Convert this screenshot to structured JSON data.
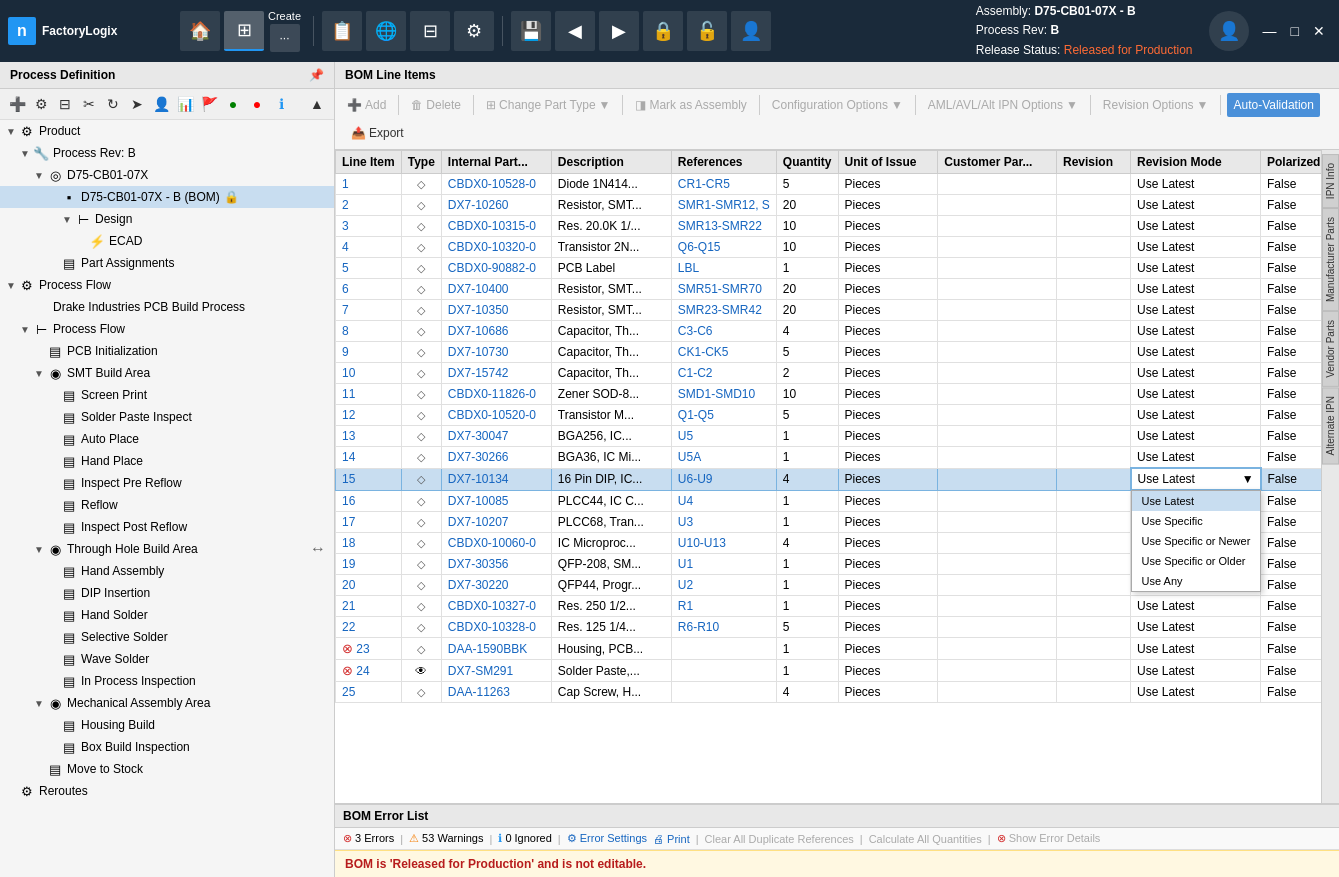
{
  "app": {
    "logo_letter": "n",
    "logo_name": "FactoryLogix"
  },
  "nav": {
    "create_label": "Create",
    "assembly_label": "Assembly:",
    "assembly_value": "D75-CB01-07X - B",
    "process_rev_label": "Process Rev:",
    "process_rev_value": "B",
    "release_status_label": "Release Status:",
    "release_status_value": "Released for Production",
    "window_min": "—",
    "window_max": "□",
    "window_close": "✕"
  },
  "left_panel": {
    "title": "Process Definition",
    "tree": [
      {
        "id": "product",
        "label": "Product",
        "level": 0,
        "type": "section",
        "expanded": true,
        "icon": "⚙"
      },
      {
        "id": "process-rev-b",
        "label": "Process Rev: B",
        "level": 1,
        "type": "node",
        "expanded": true,
        "icon": "🔧"
      },
      {
        "id": "d75",
        "label": "D75-CB01-07X",
        "level": 2,
        "type": "node",
        "expanded": true,
        "icon": "◎"
      },
      {
        "id": "bom",
        "label": "D75-CB01-07X - B (BOM)",
        "level": 3,
        "type": "bom",
        "expanded": false,
        "icon": "▪",
        "selected": true,
        "locked": true
      },
      {
        "id": "design",
        "label": "Design",
        "level": 4,
        "type": "node",
        "expanded": true,
        "icon": "⊢"
      },
      {
        "id": "ecad",
        "label": "ECAD",
        "level": 5,
        "type": "leaf",
        "icon": "⚡"
      },
      {
        "id": "part-assign",
        "label": "Part Assignments",
        "level": 3,
        "type": "leaf",
        "icon": "▤"
      },
      {
        "id": "process-flow",
        "label": "Process Flow",
        "level": 0,
        "type": "section",
        "expanded": true,
        "icon": "⚙"
      },
      {
        "id": "pf-desc",
        "label": "Drake Industries PCB Build Process",
        "level": 1,
        "type": "desc",
        "icon": ""
      },
      {
        "id": "pf-node",
        "label": "Process Flow",
        "level": 1,
        "type": "node",
        "expanded": true,
        "icon": "⊢"
      },
      {
        "id": "pcb-init",
        "label": "PCB Initialization",
        "level": 2,
        "type": "leaf",
        "icon": "▤"
      },
      {
        "id": "smt-area",
        "label": "SMT Build Area",
        "level": 2,
        "type": "node",
        "expanded": true,
        "icon": "◉"
      },
      {
        "id": "screen-print",
        "label": "Screen Print",
        "level": 3,
        "type": "leaf",
        "icon": "▤"
      },
      {
        "id": "solder-paste",
        "label": "Solder Paste Inspect",
        "level": 3,
        "type": "leaf",
        "icon": "▤"
      },
      {
        "id": "auto-place",
        "label": "Auto Place",
        "level": 3,
        "type": "leaf",
        "icon": "▤"
      },
      {
        "id": "hand-place",
        "label": "Hand Place",
        "level": 3,
        "type": "leaf",
        "icon": "▤"
      },
      {
        "id": "inspect-pre",
        "label": "Inspect Pre Reflow",
        "level": 3,
        "type": "leaf",
        "icon": "▤"
      },
      {
        "id": "reflow",
        "label": "Reflow",
        "level": 3,
        "type": "leaf",
        "icon": "▤"
      },
      {
        "id": "inspect-post",
        "label": "Inspect Post Reflow",
        "level": 3,
        "type": "leaf",
        "icon": "▤"
      },
      {
        "id": "th-area",
        "label": "Through Hole Build Area",
        "level": 2,
        "type": "node",
        "expanded": true,
        "icon": "◉"
      },
      {
        "id": "hand-assembly",
        "label": "Hand Assembly",
        "level": 3,
        "type": "leaf",
        "icon": "▤"
      },
      {
        "id": "dip-insert",
        "label": "DIP Insertion",
        "level": 3,
        "type": "leaf",
        "icon": "▤"
      },
      {
        "id": "hand-solder",
        "label": "Hand Solder",
        "level": 3,
        "type": "leaf",
        "icon": "▤"
      },
      {
        "id": "selective-solder",
        "label": "Selective Solder",
        "level": 3,
        "type": "leaf",
        "icon": "▤"
      },
      {
        "id": "wave-solder",
        "label": "Wave Solder",
        "level": 3,
        "type": "leaf",
        "icon": "▤"
      },
      {
        "id": "in-process",
        "label": "In Process Inspection",
        "level": 3,
        "type": "leaf",
        "icon": "▤"
      },
      {
        "id": "mech-area",
        "label": "Mechanical Assembly Area",
        "level": 2,
        "type": "node",
        "expanded": true,
        "icon": "◉"
      },
      {
        "id": "housing-build",
        "label": "Housing Build",
        "level": 3,
        "type": "leaf",
        "icon": "▤"
      },
      {
        "id": "box-build",
        "label": "Box Build Inspection",
        "level": 3,
        "type": "leaf",
        "icon": "▤"
      },
      {
        "id": "move-stock",
        "label": "Move to Stock",
        "level": 2,
        "type": "leaf",
        "icon": "▤"
      },
      {
        "id": "reroutes",
        "label": "Reroutes",
        "level": 0,
        "type": "section",
        "expanded": false,
        "icon": "⚙"
      }
    ]
  },
  "bom": {
    "title": "BOM Line Items",
    "toolbar": {
      "add": "Add",
      "delete": "Delete",
      "change_part_type": "Change Part Type",
      "mark_as_assembly": "Mark as Assembly",
      "config_options": "Configuration Options",
      "aml_options": "AML/AVL/Alt IPN Options",
      "revision_options": "Revision Options",
      "auto_validation": "Auto-Validation",
      "export": "Export"
    },
    "columns": [
      "Line Item",
      "Type",
      "Internal Part...",
      "Description",
      "References",
      "Quantity",
      "Unit of Issue",
      "Customer Par...",
      "Revision",
      "Revision Mode",
      "Polarized"
    ],
    "rows": [
      {
        "line": "1",
        "type": "smd",
        "internal": "CBDX0-10528-0",
        "desc": "Diode 1N414...",
        "refs": "CR1-CR5",
        "qty": "5",
        "unit": "Pieces",
        "customer": "",
        "rev": "",
        "rev_mode": "Use Latest",
        "polarized": "False",
        "error": false
      },
      {
        "line": "2",
        "type": "smd",
        "internal": "DX7-10260",
        "desc": "Resistor, SMT...",
        "refs": "SMR1-SMR12, S",
        "qty": "20",
        "unit": "Pieces",
        "customer": "",
        "rev": "",
        "rev_mode": "Use Latest",
        "polarized": "False",
        "error": false
      },
      {
        "line": "3",
        "type": "smd",
        "internal": "CBDX0-10315-0",
        "desc": "Res. 20.0K 1/...",
        "refs": "SMR13-SMR22",
        "qty": "10",
        "unit": "Pieces",
        "customer": "",
        "rev": "",
        "rev_mode": "Use Latest",
        "polarized": "False",
        "error": false
      },
      {
        "line": "4",
        "type": "smd",
        "internal": "CBDX0-10320-0",
        "desc": "Transistor 2N...",
        "refs": "Q6-Q15",
        "qty": "10",
        "unit": "Pieces",
        "customer": "",
        "rev": "",
        "rev_mode": "Use Latest",
        "polarized": "False",
        "error": false
      },
      {
        "line": "5",
        "type": "smd",
        "internal": "CBDX0-90882-0",
        "desc": "PCB Label",
        "refs": "LBL",
        "qty": "1",
        "unit": "Pieces",
        "customer": "",
        "rev": "",
        "rev_mode": "Use Latest",
        "polarized": "False",
        "error": false
      },
      {
        "line": "6",
        "type": "smd",
        "internal": "DX7-10400",
        "desc": "Resistor, SMT...",
        "refs": "SMR51-SMR70",
        "qty": "20",
        "unit": "Pieces",
        "customer": "",
        "rev": "",
        "rev_mode": "Use Latest",
        "polarized": "False",
        "error": false
      },
      {
        "line": "7",
        "type": "smd",
        "internal": "DX7-10350",
        "desc": "Resistor, SMT...",
        "refs": "SMR23-SMR42",
        "qty": "20",
        "unit": "Pieces",
        "customer": "",
        "rev": "",
        "rev_mode": "Use Latest",
        "polarized": "False",
        "error": false
      },
      {
        "line": "8",
        "type": "smd",
        "internal": "DX7-10686",
        "desc": "Capacitor, Th...",
        "refs": "C3-C6",
        "qty": "4",
        "unit": "Pieces",
        "customer": "",
        "rev": "",
        "rev_mode": "Use Latest",
        "polarized": "False",
        "error": false
      },
      {
        "line": "9",
        "type": "smd",
        "internal": "DX7-10730",
        "desc": "Capacitor, Th...",
        "refs": "CK1-CK5",
        "qty": "5",
        "unit": "Pieces",
        "customer": "",
        "rev": "",
        "rev_mode": "Use Latest",
        "polarized": "False",
        "error": false
      },
      {
        "line": "10",
        "type": "smd",
        "internal": "DX7-15742",
        "desc": "Capacitor, Th...",
        "refs": "C1-C2",
        "qty": "2",
        "unit": "Pieces",
        "customer": "",
        "rev": "",
        "rev_mode": "Use Latest",
        "polarized": "False",
        "error": false
      },
      {
        "line": "11",
        "type": "smd",
        "internal": "CBDX0-11826-0",
        "desc": "Zener SOD-8...",
        "refs": "SMD1-SMD10",
        "qty": "10",
        "unit": "Pieces",
        "customer": "",
        "rev": "",
        "rev_mode": "Use Latest",
        "polarized": "False",
        "error": false
      },
      {
        "line": "12",
        "type": "smd",
        "internal": "CBDX0-10520-0",
        "desc": "Transistor M...",
        "refs": "Q1-Q5",
        "qty": "5",
        "unit": "Pieces",
        "customer": "",
        "rev": "",
        "rev_mode": "Use Latest",
        "polarized": "False",
        "error": false
      },
      {
        "line": "13",
        "type": "smd",
        "internal": "DX7-30047",
        "desc": "BGA256, IC...",
        "refs": "U5",
        "qty": "1",
        "unit": "Pieces",
        "customer": "",
        "rev": "",
        "rev_mode": "Use Latest",
        "polarized": "False",
        "error": false
      },
      {
        "line": "14",
        "type": "smd",
        "internal": "DX7-30266",
        "desc": "BGA36, IC Mi...",
        "refs": "U5A",
        "qty": "1",
        "unit": "Pieces",
        "customer": "",
        "rev": "",
        "rev_mode": "Use Latest",
        "polarized": "False",
        "error": false
      },
      {
        "line": "15",
        "type": "smd",
        "internal": "DX7-10134",
        "desc": "16 Pin DIP, IC...",
        "refs": "U6-U9",
        "qty": "4",
        "unit": "Pieces",
        "customer": "",
        "rev": "",
        "rev_mode": "Use Latest",
        "polarized": "False",
        "error": false,
        "selected": true,
        "dropdown": true
      },
      {
        "line": "16",
        "type": "smd",
        "internal": "DX7-10085",
        "desc": "PLCC44, IC C...",
        "refs": "U4",
        "qty": "1",
        "unit": "Pieces",
        "customer": "",
        "rev": "",
        "rev_mode": "Use Latest",
        "polarized": "False",
        "error": false
      },
      {
        "line": "17",
        "type": "smd",
        "internal": "DX7-10207",
        "desc": "PLCC68, Tran...",
        "refs": "U3",
        "qty": "1",
        "unit": "Pieces",
        "customer": "",
        "rev": "",
        "rev_mode": "Use Latest",
        "polarized": "False",
        "error": false
      },
      {
        "line": "18",
        "type": "smd",
        "internal": "CBDX0-10060-0",
        "desc": "IC Microproc...",
        "refs": "U10-U13",
        "qty": "4",
        "unit": "Pieces",
        "customer": "",
        "rev": "",
        "rev_mode": "Use Latest",
        "polarized": "False",
        "error": false
      },
      {
        "line": "19",
        "type": "smd",
        "internal": "DX7-30356",
        "desc": "QFP-208, SM...",
        "refs": "U1",
        "qty": "1",
        "unit": "Pieces",
        "customer": "",
        "rev": "",
        "rev_mode": "Use Latest",
        "polarized": "False",
        "error": false
      },
      {
        "line": "20",
        "type": "smd",
        "internal": "DX7-30220",
        "desc": "QFP44, Progr...",
        "refs": "U2",
        "qty": "1",
        "unit": "Pieces",
        "customer": "",
        "rev": "",
        "rev_mode": "Use Latest",
        "polarized": "False",
        "error": false
      },
      {
        "line": "21",
        "type": "smd",
        "internal": "CBDX0-10327-0",
        "desc": "Res. 250 1/2...",
        "refs": "R1",
        "qty": "1",
        "unit": "Pieces",
        "customer": "",
        "rev": "",
        "rev_mode": "Use Latest",
        "polarized": "False",
        "error": false
      },
      {
        "line": "22",
        "type": "smd",
        "internal": "CBDX0-10328-0",
        "desc": "Res. 125 1/4...",
        "refs": "R6-R10",
        "qty": "5",
        "unit": "Pieces",
        "customer": "",
        "rev": "",
        "rev_mode": "Use Latest",
        "polarized": "False",
        "error": false
      },
      {
        "line": "23",
        "type": "smd",
        "internal": "DAA-1590BBK",
        "desc": "Housing, PCB...",
        "refs": "",
        "qty": "1",
        "unit": "Pieces",
        "customer": "",
        "rev": "",
        "rev_mode": "Use Latest",
        "polarized": "False",
        "error": true
      },
      {
        "line": "24",
        "type": "eye",
        "internal": "DX7-SM291",
        "desc": "Solder Paste,...",
        "refs": "",
        "qty": "1",
        "unit": "Pieces",
        "customer": "",
        "rev": "",
        "rev_mode": "Use Latest",
        "polarized": "False",
        "error": true
      },
      {
        "line": "25",
        "type": "smd",
        "internal": "DAA-11263",
        "desc": "Cap Screw, H...",
        "refs": "",
        "qty": "4",
        "unit": "Pieces",
        "customer": "",
        "rev": "",
        "rev_mode": "Use Latest",
        "polarized": "False",
        "error": false
      }
    ],
    "dropdown_options": [
      "Use Latest",
      "Use Specific",
      "Use Specific or Newer",
      "Use Specific or Older",
      "Use Any"
    ],
    "dropdown_selected": "Use Latest"
  },
  "error_section": {
    "title": "BOM Error List",
    "errors_count": "3 Errors",
    "warnings_count": "53 Warnings",
    "ignored_count": "0 Ignored",
    "error_settings": "Error Settings",
    "print": "Print",
    "clear_duplicates": "Clear All Duplicate References",
    "calculate_quantities": "Calculate All Quantities",
    "show_error_details": "Show Error Details",
    "readonly_message": "BOM is 'Released for Production' and is not editable."
  },
  "side_tabs": [
    "IPN Info",
    "Manufacturer Parts",
    "Vendor Parts",
    "Alternate IPN"
  ]
}
